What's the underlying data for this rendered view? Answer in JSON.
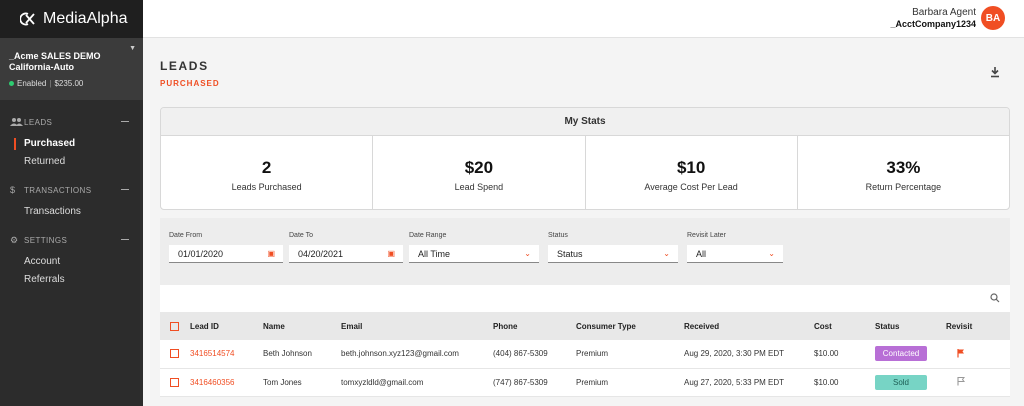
{
  "app": {
    "logo_text": "MediaAlpha"
  },
  "account": {
    "name_line1": "_Acme SALES DEMO",
    "name_line2": "California-Auto",
    "status": "Enabled",
    "balance": "$235.00"
  },
  "nav": {
    "leads": {
      "label": "LEADS",
      "items": [
        "Purchased",
        "Returned"
      ]
    },
    "transactions": {
      "label": "TRANSACTIONS",
      "items": [
        "Transactions"
      ]
    },
    "settings": {
      "label": "SETTINGS",
      "items": [
        "Account",
        "Referrals"
      ]
    }
  },
  "user": {
    "name": "Barbara Agent",
    "company": "_AcctCompany1234",
    "initials": "BA"
  },
  "page": {
    "title": "LEADS",
    "subtitle": "PURCHASED"
  },
  "stats": {
    "title": "My Stats",
    "items": [
      {
        "value": "2",
        "label": "Leads Purchased"
      },
      {
        "value": "$20",
        "label": "Lead Spend"
      },
      {
        "value": "$10",
        "label": "Average Cost Per Lead"
      },
      {
        "value": "33%",
        "label": "Return Percentage"
      }
    ]
  },
  "filters": {
    "date_from": {
      "label": "Date From",
      "value": "01/01/2020"
    },
    "date_to": {
      "label": "Date To",
      "value": "04/20/2021"
    },
    "date_range": {
      "label": "Date Range",
      "value": "All Time"
    },
    "status": {
      "label": "Status",
      "value": "Status"
    },
    "revisit_later": {
      "label": "Revisit Later",
      "value": "All"
    }
  },
  "table": {
    "headers": [
      "Lead ID",
      "Name",
      "Email",
      "Phone",
      "Consumer Type",
      "Received",
      "Cost",
      "Status",
      "Revisit"
    ],
    "rows": [
      {
        "lead_id": "3416514574",
        "name": "Beth Johnson",
        "email": "beth.johnson.xyz123@gmail.com",
        "phone": "(404) 867-5309",
        "consumer_type": "Premium",
        "received": "Aug 29, 2020, 3:30 PM EDT",
        "cost": "$10.00",
        "status": "Contacted"
      },
      {
        "lead_id": "3416460356",
        "name": "Tom Jones",
        "email": "tomxyzldld@gmail.com",
        "phone": "(747) 867-5309",
        "consumer_type": "Premium",
        "received": "Aug 27, 2020, 5:33 PM EDT",
        "cost": "$10.00",
        "status": "Sold"
      }
    ]
  },
  "colors": {
    "accent": "#f04e23",
    "contacted": "#b86fd6",
    "sold": "#77d4c5"
  },
  "icons": [
    "logo-icon",
    "people-icon",
    "dollar-icon",
    "gear-icon",
    "download-icon",
    "calendar-icon",
    "chevron-down-icon",
    "search-icon",
    "flag-icon"
  ]
}
